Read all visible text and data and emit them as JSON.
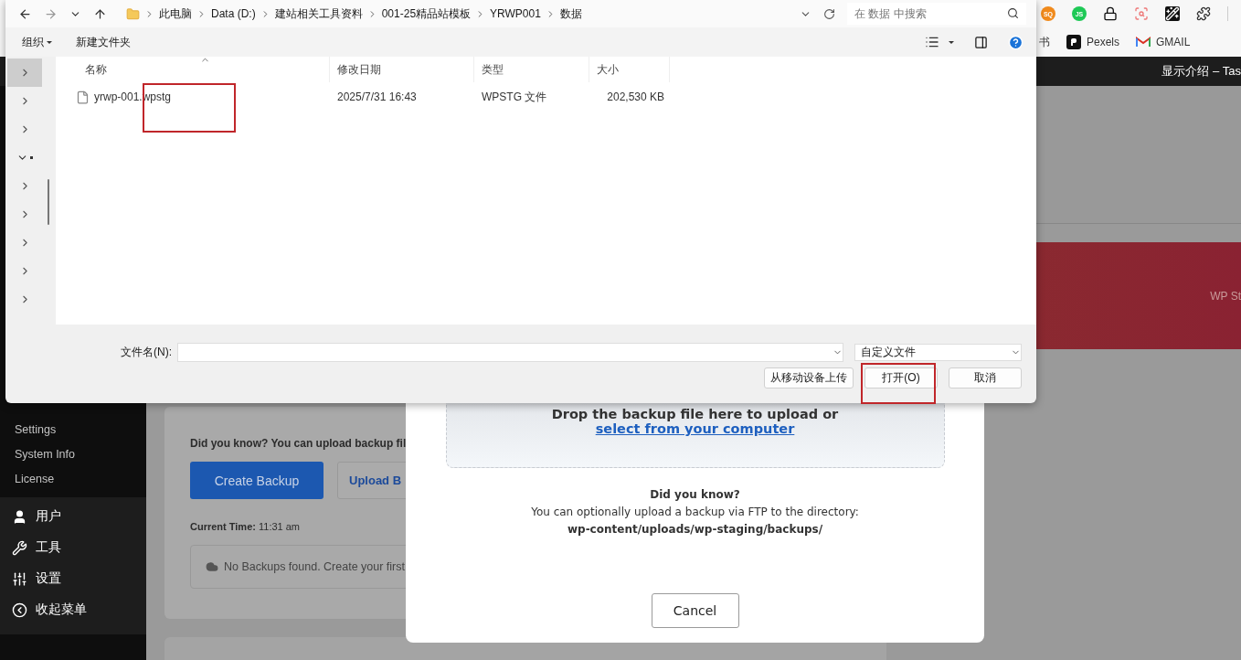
{
  "browser": {
    "extensions": [
      {
        "kind": "badge",
        "label": "SQ",
        "color": "#f08a1c"
      },
      {
        "kind": "badge",
        "label": "JS",
        "color": "#1ec956"
      },
      {
        "kind": "lock"
      },
      {
        "kind": "lens"
      },
      {
        "kind": "dark"
      },
      {
        "kind": "puzzle"
      }
    ],
    "bookmarks": [
      {
        "kind": "plain",
        "label": "书"
      },
      {
        "kind": "pexels",
        "label": "Pexels"
      },
      {
        "kind": "gmail",
        "label": "GMAIL"
      }
    ],
    "admin_bar": {
      "title": "显示介绍 – Tas"
    }
  },
  "sidebar": {
    "submenu": [
      "Settings",
      "System Info",
      "License"
    ],
    "menu": [
      {
        "kind": "user",
        "label": "用户"
      },
      {
        "kind": "wrench",
        "label": "工具"
      },
      {
        "kind": "sliders",
        "label": "设置"
      },
      {
        "kind": "collapse",
        "label": "收起菜单"
      }
    ]
  },
  "page": {
    "banner_text": "WP St",
    "card": {
      "tip": "Did you know? You can upload backup fil",
      "buttons": [
        {
          "kind": "primary",
          "label": "Create Backup"
        },
        {
          "kind": "outline",
          "label": "Upload B"
        }
      ],
      "time_label": "Current Time:",
      "time": "11:31 am",
      "empty": "No Backups found. Create your first"
    }
  },
  "upload_modal": {
    "drop_text": "Drop the backup file here to upload or",
    "link": "select from your computer",
    "tip_title": "Did you know?",
    "tip_text": "You can optionally upload a backup via FTP to the directory:",
    "path": "wp-content/uploads/wp-staging/backups/",
    "cancel": "Cancel"
  },
  "file_dialog": {
    "path": [
      "此电脑",
      "Data (D:)",
      "建站相关工具资料",
      "001-25精品站模板",
      "YRWP001",
      "数据"
    ],
    "search": {
      "placeholder": "在 数据 中搜索"
    },
    "toolbar": [
      {
        "label": "组织",
        "menu": true
      },
      {
        "label": "新建文件夹",
        "menu": false
      }
    ],
    "nav_items": [
      {
        "selected": true,
        "expanded": false
      },
      {
        "selected": false,
        "expanded": false
      },
      {
        "selected": false,
        "expanded": false
      },
      {
        "selected": false,
        "expanded": true
      },
      {
        "selected": false,
        "expanded": false
      },
      {
        "selected": false,
        "expanded": false
      },
      {
        "selected": false,
        "expanded": false
      },
      {
        "selected": false,
        "expanded": false
      },
      {
        "selected": false,
        "expanded": false
      }
    ],
    "columns": [
      "名称",
      "修改日期",
      "类型",
      "大小"
    ],
    "files": [
      {
        "name": "yrwp-001.wpstg",
        "modified": "2025/7/31 16:43",
        "type": "WPSTG 文件",
        "size": "202,530 KB",
        "highlighted": true
      }
    ],
    "filename_label": "文件名(N):",
    "file_type": "自定义文件",
    "buttons": [
      {
        "label": "从移动设备上传",
        "highlighted": false
      },
      {
        "label": "打开(O)",
        "highlighted": true
      },
      {
        "label": "取消",
        "highlighted": false
      }
    ]
  }
}
